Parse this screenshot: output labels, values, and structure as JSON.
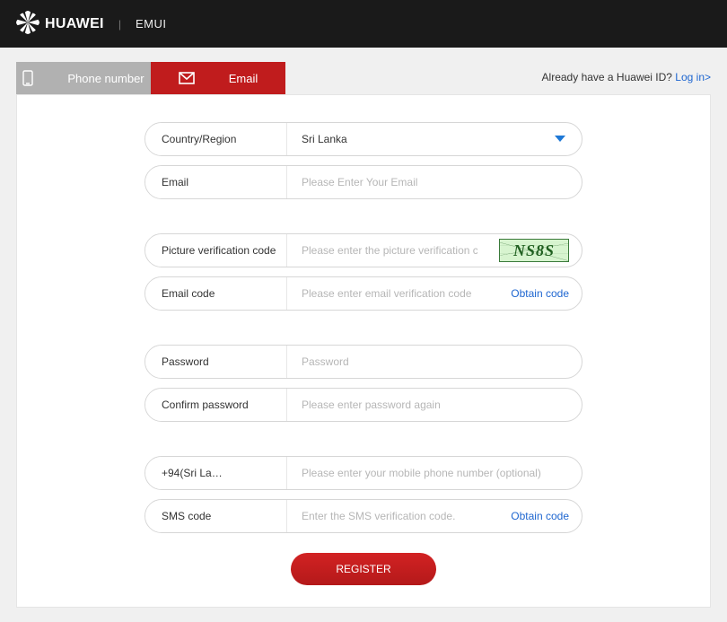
{
  "header": {
    "brand": "HUAWEI",
    "subbrand": "EMUI"
  },
  "tabs": {
    "phone_label": "Phone number",
    "email_label": "Email"
  },
  "already": {
    "prompt": "Already have a Huawei ID? ",
    "link": "Log in>"
  },
  "form": {
    "country": {
      "label": "Country/Region",
      "value": "Sri Lanka"
    },
    "email": {
      "label": "Email",
      "placeholder": "Please Enter Your Email"
    },
    "picture_code": {
      "label": "Picture verification code",
      "placeholder": "Please enter the picture verification code",
      "captcha_text": "NS8S"
    },
    "email_code": {
      "label": "Email code",
      "placeholder": "Please enter email verification code",
      "obtain": "Obtain code"
    },
    "password": {
      "label": "Password",
      "placeholder": "Password"
    },
    "confirm_password": {
      "label": "Confirm password",
      "placeholder": "Please enter password again"
    },
    "phone": {
      "country_code": "+94(Sri La…",
      "placeholder": "Please enter your mobile phone number (optional)"
    },
    "sms_code": {
      "label": "SMS code",
      "placeholder": "Enter the SMS verification code.",
      "obtain": "Obtain code"
    },
    "register_btn": "REGISTER"
  }
}
